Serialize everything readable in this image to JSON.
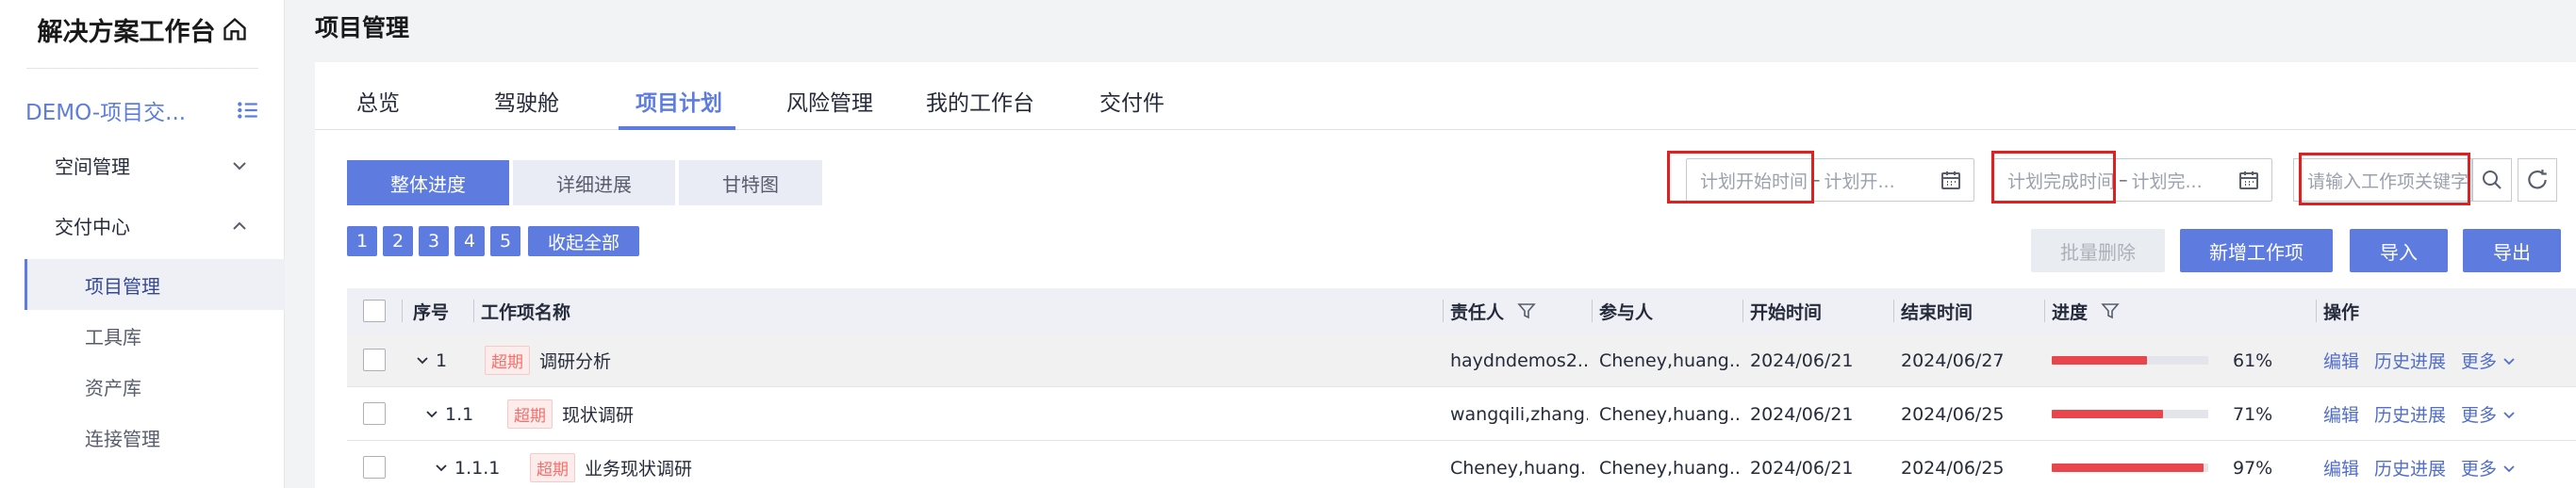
{
  "sidebar": {
    "brand": "解决方案工作台",
    "project_name": "DEMO-项目交...",
    "groups": [
      {
        "label": "空间管理"
      },
      {
        "label": "交付中心"
      }
    ],
    "items": [
      {
        "label": "项目管理"
      },
      {
        "label": "工具库"
      },
      {
        "label": "资产库"
      },
      {
        "label": "连接管理"
      }
    ]
  },
  "header": {
    "title": "项目管理"
  },
  "tabs": [
    "总览",
    "驾驶舱",
    "项目计划",
    "风险管理",
    "我的工作台",
    "交付件"
  ],
  "view_segments": [
    "整体进度",
    "详细进展",
    "甘特图"
  ],
  "filters": {
    "plan_start_from": "计划开始时间",
    "plan_start_to": "计划开...",
    "plan_end_from": "计划完成时间",
    "plan_end_to": "计划完...",
    "range_sep": "–",
    "keyword_placeholder": "请输入工作项关键字"
  },
  "levels": [
    "1",
    "2",
    "3",
    "4",
    "5"
  ],
  "collapse_all": "收起全部",
  "actions": {
    "batch_delete": "批量删除",
    "new_item": "新增工作项",
    "import": "导入",
    "export": "导出"
  },
  "table": {
    "columns": {
      "no": "序号",
      "name": "工作项名称",
      "owner": "责任人",
      "participants": "参与人",
      "start": "开始时间",
      "end": "结束时间",
      "progress": "进度",
      "ops": "操作"
    },
    "rows": [
      {
        "no": "1",
        "overdue": "超期",
        "name": "调研分析",
        "owner": "haydndemos2...",
        "participants": "Cheney,huang...",
        "start": "2024/06/21",
        "end": "2024/06/27",
        "progress": 61,
        "progress_label": "61%"
      },
      {
        "no": "1.1",
        "overdue": "超期",
        "name": "现状调研",
        "owner": "wangqili,zhang...",
        "participants": "Cheney,huang...",
        "start": "2024/06/21",
        "end": "2024/06/25",
        "progress": 71,
        "progress_label": "71%"
      },
      {
        "no": "1.1.1",
        "overdue": "超期",
        "name": "业务现状调研",
        "owner": "Cheney,huang...",
        "participants": "Cheney,huang...",
        "start": "2024/06/21",
        "end": "2024/06/25",
        "progress": 97,
        "progress_label": "97%"
      }
    ],
    "row_ops": {
      "edit": "编辑",
      "history": "历史进展",
      "more": "更多"
    }
  },
  "colors": {
    "accent": "#5e7ce0",
    "progress": "#e8464c",
    "overdue": "#f66f6a",
    "highlight": "#e02020"
  }
}
